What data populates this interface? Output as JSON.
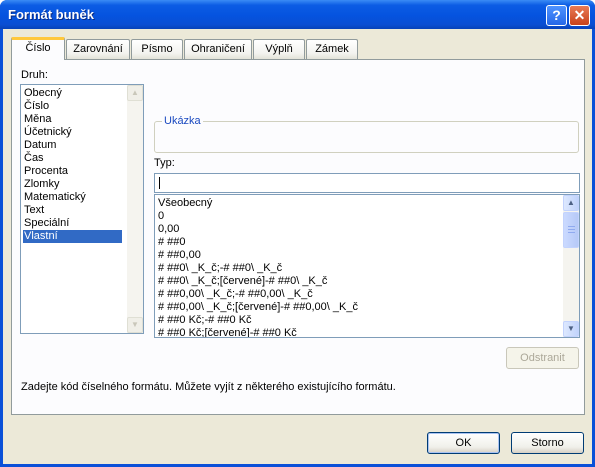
{
  "window": {
    "title": "Formát buněk",
    "help_glyph": "?",
    "close_glyph": "✕"
  },
  "tabs": [
    {
      "label": "Číslo",
      "active": true
    },
    {
      "label": "Zarovnání"
    },
    {
      "label": "Písmo"
    },
    {
      "label": "Ohraničení"
    },
    {
      "label": "Výplň"
    },
    {
      "label": "Zámek"
    }
  ],
  "category": {
    "label": "Druh:",
    "items": [
      "Obecný",
      "Číslo",
      "Měna",
      "Účetnický",
      "Datum",
      "Čas",
      "Procenta",
      "Zlomky",
      "Matematický",
      "Text",
      "Speciální",
      "Vlastní"
    ],
    "selected": "Vlastní"
  },
  "sample": {
    "label": "Ukázka",
    "value": ""
  },
  "type": {
    "label": "Typ:",
    "value": "",
    "formats": [
      "Všeobecný",
      "0",
      "0,00",
      "# ##0",
      "# ##0,00",
      "# ##0\\ _K_č;-# ##0\\ _K_č",
      "# ##0\\ _K_č;[červené]-# ##0\\ _K_č",
      "# ##0,00\\ _K_č;-# ##0,00\\ _K_č",
      "# ##0,00\\ _K_č;[červené]-# ##0,00\\ _K_č",
      "# ##0 Kč;-# ##0 Kč",
      "# ##0 Kč;[červené]-# ##0 Kč"
    ]
  },
  "delete_button": "Odstranit",
  "description": "Zadejte kód číselného formátu. Můžete vyjít z některého existujícího formátu.",
  "ok_button": "OK",
  "cancel_button": "Storno"
}
